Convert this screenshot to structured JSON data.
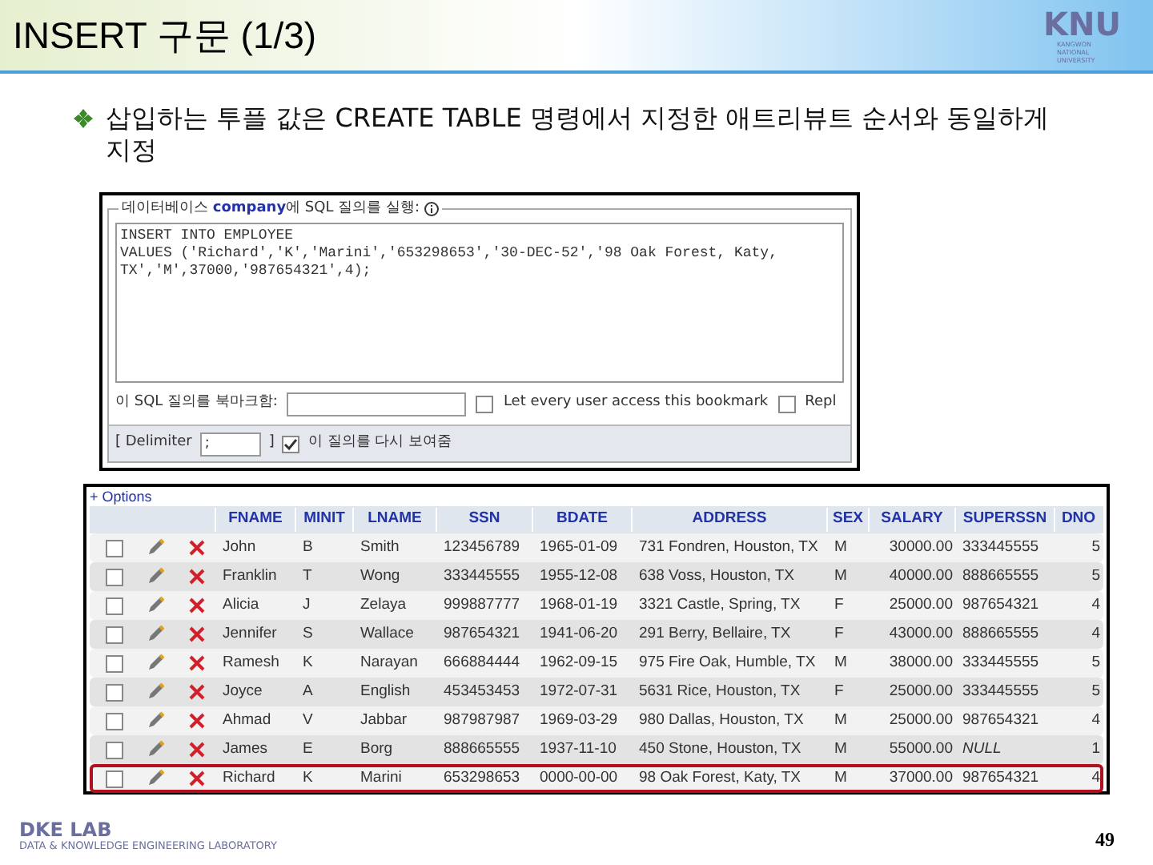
{
  "slide": {
    "title": "INSERT 구문 (1/3)",
    "logo": {
      "mark": "KNU",
      "subtitle": "KANGWON NATIONAL UNIVERSITY"
    },
    "bullet": "삽입하는 투플 값은 CREATE TABLE 명령에서 지정한 애트리뷰트 순서와 동일하게 지정",
    "footer": {
      "lab": "DKE LAB",
      "lab_full": "DATA & KNOWLEDGE ENGINEERING LABORATORY",
      "page": "49"
    }
  },
  "sql_panel": {
    "legend_prefix": "데이터베이스 ",
    "database": "company",
    "legend_suffix": "에 SQL 질의를 실행:",
    "query_lines": [
      "INSERT INTO EMPLOYEE",
      "VALUES ('Richard','K','Marini','653298653','30-DEC-52','98 Oak Forest, Katy,",
      "TX','M',37000,'987654321',4);"
    ],
    "bookmark_label": "이 SQL 질의를 북마크함:",
    "share_label": "Let every user access this bookmark",
    "share_checked": false,
    "replace_label": "Repl",
    "replace_checked": false,
    "delimiter_label": "[ Delimiter",
    "delimiter_value": ";",
    "delimiter_close": "]",
    "show_again_label": "이 질의를 다시 보여줌",
    "show_again_checked": true
  },
  "table": {
    "options": "+ Options",
    "columns": [
      "FNAME",
      "MINIT",
      "LNAME",
      "SSN",
      "BDATE",
      "ADDRESS",
      "SEX",
      "SALARY",
      "SUPERSSN",
      "DNO"
    ],
    "rows": [
      {
        "checked": false,
        "highlighted": false,
        "cells": [
          "John",
          "B",
          "Smith",
          "123456789",
          "1965-01-09",
          "731 Fondren, Houston, TX",
          "M",
          "30000.00",
          "333445555",
          "5"
        ]
      },
      {
        "checked": false,
        "highlighted": false,
        "cells": [
          "Franklin",
          "T",
          "Wong",
          "333445555",
          "1955-12-08",
          "638 Voss, Houston, TX",
          "M",
          "40000.00",
          "888665555",
          "5"
        ]
      },
      {
        "checked": false,
        "highlighted": false,
        "cells": [
          "Alicia",
          "J",
          "Zelaya",
          "999887777",
          "1968-01-19",
          "3321 Castle, Spring, TX",
          "F",
          "25000.00",
          "987654321",
          "4"
        ]
      },
      {
        "checked": false,
        "highlighted": false,
        "cells": [
          "Jennifer",
          "S",
          "Wallace",
          "987654321",
          "1941-06-20",
          "291 Berry, Bellaire, TX",
          "F",
          "43000.00",
          "888665555",
          "4"
        ]
      },
      {
        "checked": false,
        "highlighted": false,
        "cells": [
          "Ramesh",
          "K",
          "Narayan",
          "666884444",
          "1962-09-15",
          "975 Fire Oak, Humble, TX",
          "M",
          "38000.00",
          "333445555",
          "5"
        ]
      },
      {
        "checked": false,
        "highlighted": false,
        "cells": [
          "Joyce",
          "A",
          "English",
          "453453453",
          "1972-07-31",
          "5631 Rice, Houston, TX",
          "F",
          "25000.00",
          "333445555",
          "5"
        ]
      },
      {
        "checked": false,
        "highlighted": false,
        "cells": [
          "Ahmad",
          "V",
          "Jabbar",
          "987987987",
          "1969-03-29",
          "980 Dallas, Houston, TX",
          "M",
          "25000.00",
          "987654321",
          "4"
        ]
      },
      {
        "checked": false,
        "highlighted": false,
        "cells": [
          "James",
          "E",
          "Borg",
          "888665555",
          "1937-11-10",
          "450 Stone, Houston, TX",
          "M",
          "55000.00",
          "NULL",
          "1"
        ]
      },
      {
        "checked": false,
        "highlighted": true,
        "cells": [
          "Richard",
          "K",
          "Marini",
          "653298653",
          "0000-00-00",
          "98 Oak Forest, Katy, TX",
          "M",
          "37000.00",
          "987654321",
          "4"
        ]
      }
    ]
  }
}
